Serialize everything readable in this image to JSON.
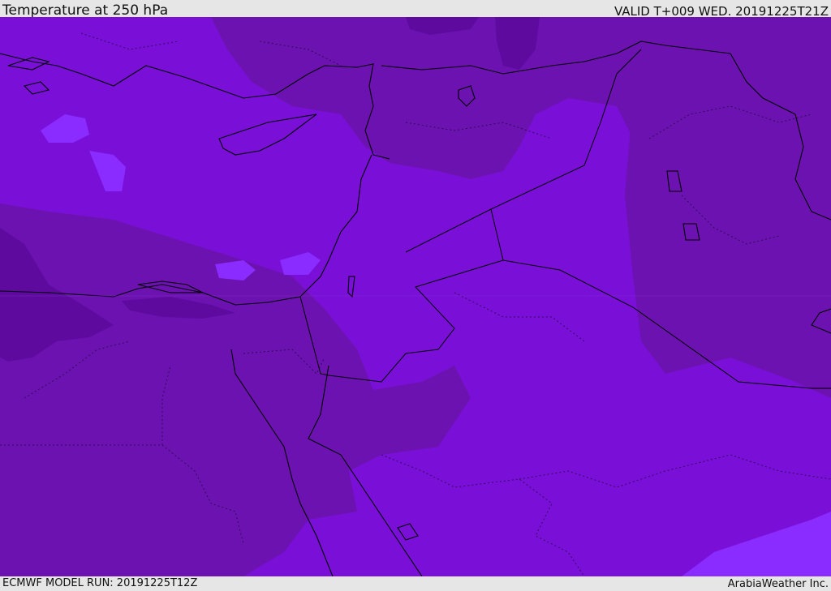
{
  "header": {
    "title": "Temperature at 250 hPa",
    "valid": "VALID T+009 WED. 20191225T21Z"
  },
  "footer": {
    "model_run": "ECMWF MODEL RUN: 20191225T12Z",
    "credit": "ArabiaWeather Inc."
  },
  "colors": {
    "background": "#e6e6e6",
    "temp_coldest": "#5e0a9e",
    "temp_cold": "#6c12b0",
    "temp_mid": "#7a0fd8",
    "temp_warm": "#7d00e6",
    "temp_warmest": "#8a2cff",
    "coastline": "#000000",
    "border": "#000000"
  }
}
